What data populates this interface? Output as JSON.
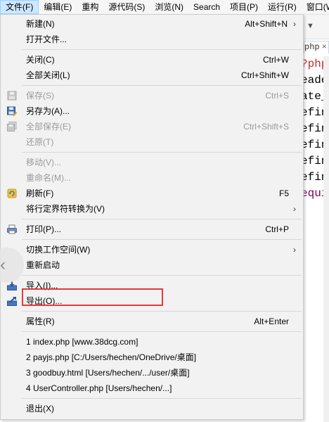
{
  "menubar": {
    "items": [
      {
        "label": "文件(F)"
      },
      {
        "label": "编辑(E)"
      },
      {
        "label": "重构"
      },
      {
        "label": "源代码(S)"
      },
      {
        "label": "浏览(N)"
      },
      {
        "label": "Search"
      },
      {
        "label": "项目(P)"
      },
      {
        "label": "运行(R)"
      },
      {
        "label": "窗口(W"
      }
    ]
  },
  "editor": {
    "tab_label": "php",
    "tab_close": "×",
    "lines": [
      {
        "text": "?php",
        "color": "#c52b2b"
      },
      {
        "text": "eade",
        "color": "#000000"
      },
      {
        "text": "ate_",
        "color": "#000000"
      },
      {
        "text": "efin",
        "color": "#000000"
      },
      {
        "text": "efin",
        "color": "#000000"
      },
      {
        "text": "efin",
        "color": "#000000"
      },
      {
        "text": "efin",
        "color": "#000000"
      },
      {
        "text": "efin",
        "color": "#000000"
      },
      {
        "text": "equi",
        "color": "#7f0055"
      }
    ]
  },
  "file_menu": {
    "new": {
      "label": "新建(N)",
      "shortcut": "Alt+Shift+N",
      "submenu": "›"
    },
    "open_file": {
      "label": "打开文件..."
    },
    "close": {
      "label": "关闭(C)",
      "shortcut": "Ctrl+W"
    },
    "close_all": {
      "label": "全部关闭(L)",
      "shortcut": "Ctrl+Shift+W"
    },
    "save": {
      "label": "保存(S)",
      "shortcut": "Ctrl+S"
    },
    "save_as": {
      "label": "另存为(A)..."
    },
    "save_all": {
      "label": "全部保存(E)",
      "shortcut": "Ctrl+Shift+S"
    },
    "revert": {
      "label": "还原(T)"
    },
    "move": {
      "label": "移动(V)..."
    },
    "rename": {
      "label": "重命名(M)..."
    },
    "refresh": {
      "label": "刷新(F)",
      "shortcut": "F5"
    },
    "convert_line_delimiters": {
      "label": "将行定界符转换为(V)",
      "submenu": "›"
    },
    "print": {
      "label": "打印(P)...",
      "shortcut": "Ctrl+P"
    },
    "switch_workspace": {
      "label": "切换工作空间(W)",
      "submenu": "›"
    },
    "restart": {
      "label": "重新启动"
    },
    "import": {
      "label": "导入(I)..."
    },
    "export": {
      "label": "导出(O)..."
    },
    "properties": {
      "label": "属性(R)",
      "shortcut": "Alt+Enter"
    },
    "recent_files": [
      {
        "label": "1 index.php  [www.38dcg.com]"
      },
      {
        "label": "2 payjs.php  [C:/Users/hechen/OneDrive/桌面]"
      },
      {
        "label": "3 goodbuy.html  [Users/hechen/.../user/桌面]"
      },
      {
        "label": "4 UserController.php  [Users/hechen/...]"
      }
    ],
    "exit": {
      "label": "退出(X)"
    }
  },
  "handle": {
    "chevron": "‹"
  },
  "colors": {
    "highlight_border": "#e33b3b",
    "menu_bg": "#f2f2f2",
    "menubar_active": "#cce8ff"
  }
}
